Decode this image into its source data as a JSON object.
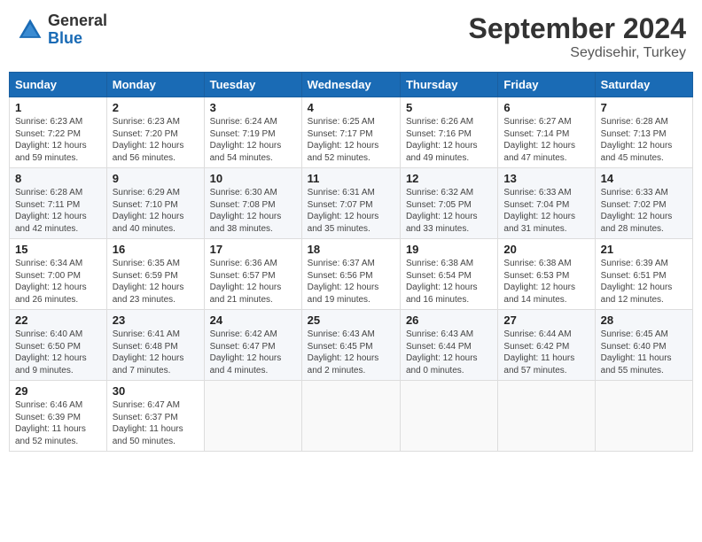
{
  "header": {
    "logo_general": "General",
    "logo_blue": "Blue",
    "month_year": "September 2024",
    "location": "Seydisehir, Turkey"
  },
  "weekdays": [
    "Sunday",
    "Monday",
    "Tuesday",
    "Wednesday",
    "Thursday",
    "Friday",
    "Saturday"
  ],
  "weeks": [
    [
      {
        "day": "1",
        "info": "Sunrise: 6:23 AM\nSunset: 7:22 PM\nDaylight: 12 hours\nand 59 minutes."
      },
      {
        "day": "2",
        "info": "Sunrise: 6:23 AM\nSunset: 7:20 PM\nDaylight: 12 hours\nand 56 minutes."
      },
      {
        "day": "3",
        "info": "Sunrise: 6:24 AM\nSunset: 7:19 PM\nDaylight: 12 hours\nand 54 minutes."
      },
      {
        "day": "4",
        "info": "Sunrise: 6:25 AM\nSunset: 7:17 PM\nDaylight: 12 hours\nand 52 minutes."
      },
      {
        "day": "5",
        "info": "Sunrise: 6:26 AM\nSunset: 7:16 PM\nDaylight: 12 hours\nand 49 minutes."
      },
      {
        "day": "6",
        "info": "Sunrise: 6:27 AM\nSunset: 7:14 PM\nDaylight: 12 hours\nand 47 minutes."
      },
      {
        "day": "7",
        "info": "Sunrise: 6:28 AM\nSunset: 7:13 PM\nDaylight: 12 hours\nand 45 minutes."
      }
    ],
    [
      {
        "day": "8",
        "info": "Sunrise: 6:28 AM\nSunset: 7:11 PM\nDaylight: 12 hours\nand 42 minutes."
      },
      {
        "day": "9",
        "info": "Sunrise: 6:29 AM\nSunset: 7:10 PM\nDaylight: 12 hours\nand 40 minutes."
      },
      {
        "day": "10",
        "info": "Sunrise: 6:30 AM\nSunset: 7:08 PM\nDaylight: 12 hours\nand 38 minutes."
      },
      {
        "day": "11",
        "info": "Sunrise: 6:31 AM\nSunset: 7:07 PM\nDaylight: 12 hours\nand 35 minutes."
      },
      {
        "day": "12",
        "info": "Sunrise: 6:32 AM\nSunset: 7:05 PM\nDaylight: 12 hours\nand 33 minutes."
      },
      {
        "day": "13",
        "info": "Sunrise: 6:33 AM\nSunset: 7:04 PM\nDaylight: 12 hours\nand 31 minutes."
      },
      {
        "day": "14",
        "info": "Sunrise: 6:33 AM\nSunset: 7:02 PM\nDaylight: 12 hours\nand 28 minutes."
      }
    ],
    [
      {
        "day": "15",
        "info": "Sunrise: 6:34 AM\nSunset: 7:00 PM\nDaylight: 12 hours\nand 26 minutes."
      },
      {
        "day": "16",
        "info": "Sunrise: 6:35 AM\nSunset: 6:59 PM\nDaylight: 12 hours\nand 23 minutes."
      },
      {
        "day": "17",
        "info": "Sunrise: 6:36 AM\nSunset: 6:57 PM\nDaylight: 12 hours\nand 21 minutes."
      },
      {
        "day": "18",
        "info": "Sunrise: 6:37 AM\nSunset: 6:56 PM\nDaylight: 12 hours\nand 19 minutes."
      },
      {
        "day": "19",
        "info": "Sunrise: 6:38 AM\nSunset: 6:54 PM\nDaylight: 12 hours\nand 16 minutes."
      },
      {
        "day": "20",
        "info": "Sunrise: 6:38 AM\nSunset: 6:53 PM\nDaylight: 12 hours\nand 14 minutes."
      },
      {
        "day": "21",
        "info": "Sunrise: 6:39 AM\nSunset: 6:51 PM\nDaylight: 12 hours\nand 12 minutes."
      }
    ],
    [
      {
        "day": "22",
        "info": "Sunrise: 6:40 AM\nSunset: 6:50 PM\nDaylight: 12 hours\nand 9 minutes."
      },
      {
        "day": "23",
        "info": "Sunrise: 6:41 AM\nSunset: 6:48 PM\nDaylight: 12 hours\nand 7 minutes."
      },
      {
        "day": "24",
        "info": "Sunrise: 6:42 AM\nSunset: 6:47 PM\nDaylight: 12 hours\nand 4 minutes."
      },
      {
        "day": "25",
        "info": "Sunrise: 6:43 AM\nSunset: 6:45 PM\nDaylight: 12 hours\nand 2 minutes."
      },
      {
        "day": "26",
        "info": "Sunrise: 6:43 AM\nSunset: 6:44 PM\nDaylight: 12 hours\nand 0 minutes."
      },
      {
        "day": "27",
        "info": "Sunrise: 6:44 AM\nSunset: 6:42 PM\nDaylight: 11 hours\nand 57 minutes."
      },
      {
        "day": "28",
        "info": "Sunrise: 6:45 AM\nSunset: 6:40 PM\nDaylight: 11 hours\nand 55 minutes."
      }
    ],
    [
      {
        "day": "29",
        "info": "Sunrise: 6:46 AM\nSunset: 6:39 PM\nDaylight: 11 hours\nand 52 minutes."
      },
      {
        "day": "30",
        "info": "Sunrise: 6:47 AM\nSunset: 6:37 PM\nDaylight: 11 hours\nand 50 minutes."
      },
      {
        "day": "",
        "info": ""
      },
      {
        "day": "",
        "info": ""
      },
      {
        "day": "",
        "info": ""
      },
      {
        "day": "",
        "info": ""
      },
      {
        "day": "",
        "info": ""
      }
    ]
  ]
}
